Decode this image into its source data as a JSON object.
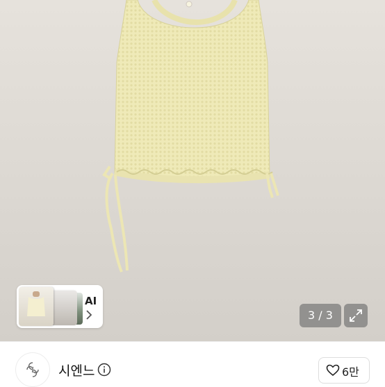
{
  "product_image": {
    "description": "knit-tank-photo"
  },
  "ai_button": {
    "label": "AI"
  },
  "gallery": {
    "counter": "3 / 3"
  },
  "seller": {
    "name": "시엔느"
  },
  "like": {
    "count": "6만"
  }
}
